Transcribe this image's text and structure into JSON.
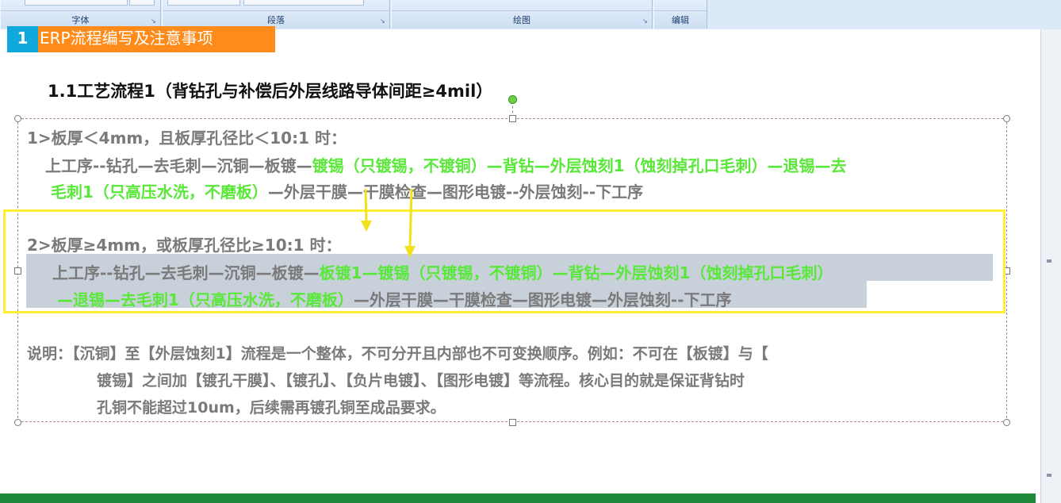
{
  "ribbon": {
    "groups": [
      {
        "label": "字体"
      },
      {
        "label": "段落"
      },
      {
        "label": "绘图"
      },
      {
        "label": "编辑"
      }
    ]
  },
  "document": {
    "heading1": {
      "number": "1",
      "text": "ERP流程编写及注意事项"
    },
    "heading2": {
      "text": "1.1工艺流程1（背钻孔与补偿后外层线路导体间距≥4mil）"
    },
    "case1": {
      "condition": "1>板厚＜4mm，且板厚孔径比＜10:1 时：",
      "line1_gray": "上工序--钻孔—去毛刺—沉铜—板镀—",
      "line1_green": "镀锡（只镀锡，不镀铜）—背钻—外层蚀刻1（蚀刻掉孔口毛刺）—退锡—去",
      "line2_green": "毛刺1（只高压水洗，不磨板）",
      "line2_gray": "—外层干膜—干膜检查—图形电镀--外层蚀刻--下工序"
    },
    "case2": {
      "condition": "2>板厚≥4mm，或板厚孔径比≥10:1 时：",
      "line1_gray": "上工序--钻孔—去毛刺—沉铜—板镀—",
      "line1_green": "板镀1—镀锡（只镀锡，不镀铜）—背钻—外层蚀刻1（蚀刻掉孔口毛刺）",
      "line2_green": "—退锡—去毛刺1（只高压水洗，不磨板）",
      "line2_gray": "—外层干膜—干膜检查—图形电镀—外层蚀刻--下工序"
    },
    "note": {
      "line1": "说明：【沉铜】至【外层蚀刻1】流程是一个整体，不可分开且内部也不可变换顺序。例如：不可在【板镀】与【",
      "line2": "镀锡】之间加【镀孔干膜】、【镀孔】、【负片电镀】、【图形电镀】等流程。核心目的就是保证背钻时",
      "line3": "孔铜不能超过10um，后续需再镀孔铜至成品要求。"
    }
  },
  "colors": {
    "green_text": "#59e83a",
    "gray_text": "#7a7a7a",
    "highlight_box": "#ffee33",
    "heading_number_bg": "#11a8dd",
    "heading_text_bg": "#ff8c1a",
    "selection": "#c8d0da"
  }
}
